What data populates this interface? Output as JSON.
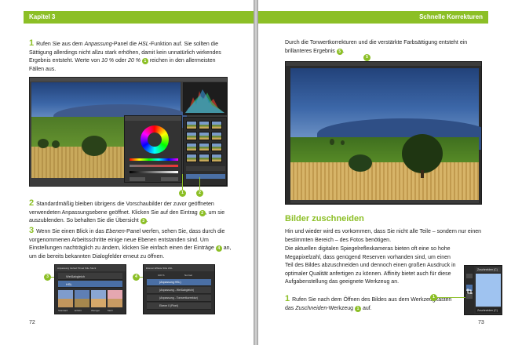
{
  "left": {
    "header": "Kapitel 3",
    "step1": {
      "num": "1",
      "t1": " Rufen Sie aus dem ",
      "em1": "Anpassung",
      "t2": "-Panel die ",
      "em2": "HSL",
      "t3": "-Funktion auf. Sie sollten die Sättigung allerdings nicht allzu stark erhöhen, damit kein unnatürlich wirkendes Ergebnis entsteht. Werte von ",
      "em3": "10 %",
      "t4": " oder ",
      "em4": "20 %",
      "t5": " reichen in den allermeisten Fällen aus.",
      "badge": "1"
    },
    "shot_markers": [
      "1",
      "2"
    ],
    "step2": {
      "num": "2",
      "t1": " Standardmäßig bleiben übrigens die Vorschaubilder der zuvor geöffneten verwendeten Anpassungsebene geöffnet. Klicken Sie auf den Eintrag ",
      "b1": "2",
      "t2": ", um sie auszublenden. So behalten Sie die Übersicht ",
      "b2": "3",
      "t3": "."
    },
    "step3": {
      "num": "3",
      "t1": " Wenn Sie einen Blick in das ",
      "em1": "Ebenen",
      "t2": "-Panel werfen, sehen Sie, dass durch die vorgenommenen Arbeitsschritte einige neue Ebenen entstanden sind. Um Einstellungen nachträglich zu ändern, klicken Sie einfach einen der Einträge ",
      "b1": "4",
      "t3": " an, um die bereits bekannten Dialogfelder erneut zu öffnen."
    },
    "mini_markers": [
      "3",
      "4"
    ],
    "mini1": {
      "tabs": "Anpassung  Verlauf  Pinsel  Stile  Stock",
      "rows": [
        "Weißabgleich",
        "HSL"
      ],
      "swatch_labels": [
        "Standard",
        "Erhöht",
        "Weniger",
        "Mehr"
      ]
    },
    "mini2": {
      "tabs": "Ebenen  Effekte  Stile  HSL",
      "opacity": "100 %",
      "mode": "Normal",
      "rows": [
        "(Anpassung HSL)",
        "(Anpassung - Weißabgleich)",
        "(Anpassung - Tonwertkorrektur)",
        "Ebene 0 (Pixel)"
      ]
    },
    "page_number": "72"
  },
  "right": {
    "header": "Schnelle Korrekturen",
    "intro": {
      "t1": "Durch die Tonwertkorrekturen und die verstärkte Farbsättigung entsteht ein brillanteres Ergebnis ",
      "b1": "5",
      "t2": "."
    },
    "shot_marker": "5",
    "heading": "Bilder zuschneiden",
    "p1": "Hin und wieder wird es vorkommen, dass Sie nicht alle Teile – sondern nur einen bestimmten Bereich – des Fotos benötigen.",
    "p2": "Die aktuellen digitalen Spiegelreflexkameras bieten oft eine so hohe Megapixelzahl, dass genügend Reserven vorhanden sind, um einen Teil des Bildes abzuschneiden und dennoch einen großen Ausdruck in optimaler Qualität anfertigen zu können. Affinity bietet auch für diese Aufgabenstellung das geeignete Werkzeug an.",
    "step1": {
      "num": "1",
      "t1": " Rufen Sie nach dem Öffnen des Bildes aus dem Werkzeugkasten das ",
      "em1": "Zuschneiden",
      "t2": "-Werkzeug ",
      "b1": "1",
      "t3": " auf."
    },
    "tool_marker": "1",
    "tool_tooltip_top": "Zuschneiden (C)",
    "tool_tooltip_bottom": "Zuschneiden (C)",
    "page_number": "73"
  },
  "colors": {
    "accent": "#8cbf26"
  }
}
